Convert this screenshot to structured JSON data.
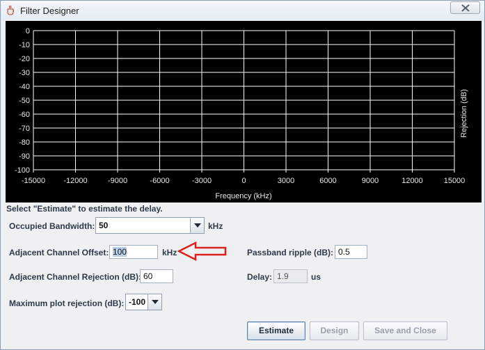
{
  "window": {
    "title": "Filter Designer",
    "icon": "java-cup-icon",
    "close_icon": "close-icon"
  },
  "plot": {
    "y_axis_label": "Rejection (dB)",
    "x_axis_label": "Frequency (kHz)",
    "background": "#000000",
    "grid_color": "#ffffff"
  },
  "chart_data": {
    "type": "line",
    "title": "",
    "xlabel": "Frequency (kHz)",
    "ylabel": "Rejection (dB)",
    "xlim": [
      -15000,
      15000
    ],
    "ylim": [
      -100,
      0
    ],
    "xticks": [
      -15000,
      -12000,
      -9000,
      -6000,
      -3000,
      0,
      3000,
      6000,
      9000,
      12000,
      15000
    ],
    "yticks": [
      0,
      -10,
      -20,
      -30,
      -40,
      -50,
      -60,
      -70,
      -80,
      -90,
      -100
    ],
    "grid": true,
    "series": []
  },
  "form": {
    "status_text": "Select \"Estimate\" to estimate the delay.",
    "occupied_bandwidth": {
      "label": "Occupied Bandwidth:",
      "value": "50",
      "unit": "kHz"
    },
    "adjacent_channel_offset": {
      "label": "Adjacent Channel Offset:",
      "value": "100",
      "unit": "kHz"
    },
    "adjacent_channel_rejection": {
      "label": "Adjacent Channel Rejection (dB):",
      "value": "60"
    },
    "max_plot_rejection": {
      "label": "Maximum plot rejection (dB):",
      "value": "-100"
    },
    "passband_ripple": {
      "label": "Passband ripple (dB):",
      "value": "0.5"
    },
    "delay": {
      "label": "Delay:",
      "value": "1.9",
      "unit": "us"
    }
  },
  "buttons": {
    "estimate": "Estimate",
    "design": "Design",
    "save_and_close": "Save and Close"
  },
  "colors": {
    "annotation_arrow": "#e02020",
    "label_text": "#2d3a4a",
    "disabled_text": "#98a2ad"
  }
}
